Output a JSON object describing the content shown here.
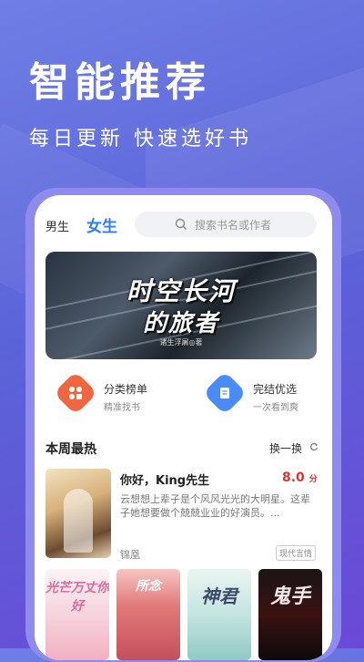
{
  "hero": {
    "title": "智能推荐",
    "subtitle": "每日更新  快速选好书"
  },
  "topbar": {
    "tab_male": "男生",
    "tab_female": "女生",
    "search_placeholder": "搜索书名或作者"
  },
  "banner": {
    "title_line1": "时空长河",
    "title_line2": "的旅者",
    "author": "诸生浮屠◎著"
  },
  "features": [
    {
      "title": "分类榜单",
      "subtitle": "精准找书",
      "color": "#f0663e"
    },
    {
      "title": "完结优选",
      "subtitle": "一次看到爽",
      "color": "#4a8cf7"
    }
  ],
  "section": {
    "title": "本周最热",
    "refresh_label": "换一换"
  },
  "featured_book": {
    "title": "你好，King先生",
    "score": "8.0",
    "score_unit": "分",
    "description": "云想想上辈子是个风风光光的大明星。这辈子她想要做个兢兢业业的好演员。...",
    "author": "锦凰",
    "tag": "现代言情"
  },
  "book_row": [
    {
      "cover_text": "光芒万丈你好",
      "color": "#e06aa0"
    },
    {
      "cover_text": "所念",
      "color": "#ffffff"
    },
    {
      "cover_text": "神君",
      "color": "#3f4a6b"
    },
    {
      "cover_text": "鬼手",
      "color": "#f3e8e8"
    }
  ]
}
